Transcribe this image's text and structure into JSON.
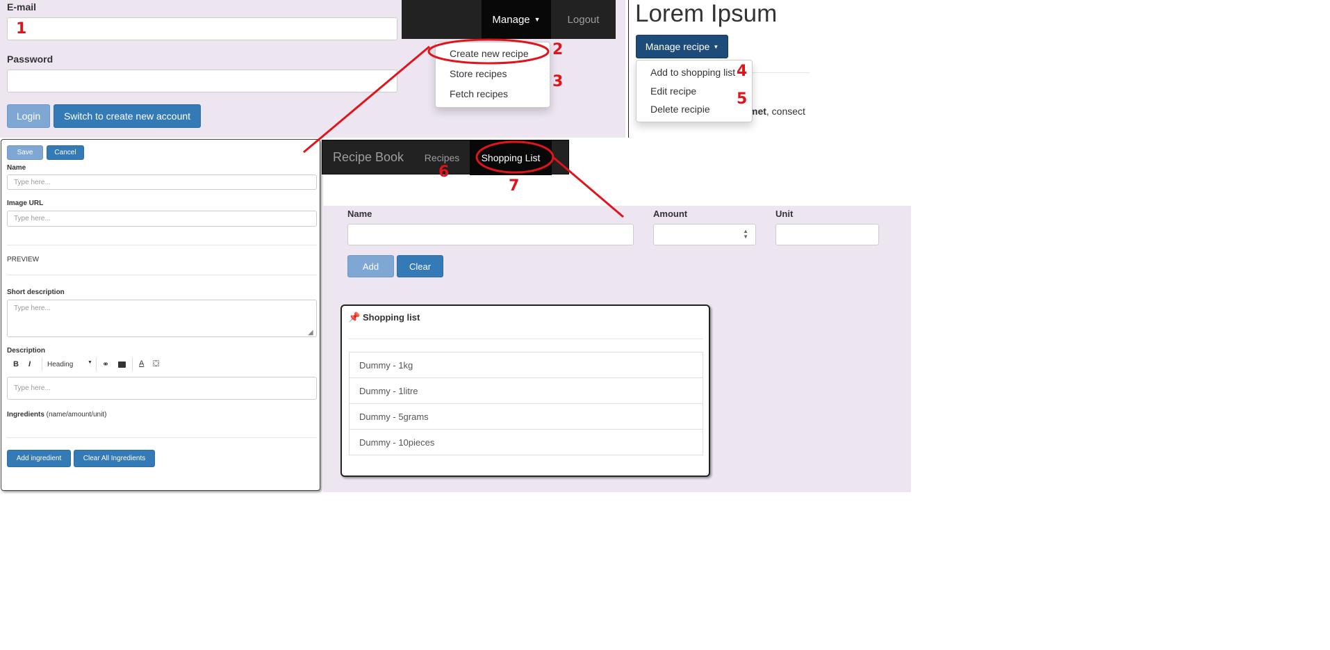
{
  "login": {
    "email_label": "E-mail",
    "password_label": "Password",
    "login_button": "Login",
    "switch_button": "Switch to create new account"
  },
  "topnav": {
    "manage": "Manage",
    "logout": "Logout",
    "menu": [
      "Create new recipe",
      "Store recipes",
      "Fetch recipes"
    ]
  },
  "recipe_detail": {
    "title": "Lorem Ipsum",
    "manage_button": "Manage recipe",
    "menu": [
      "Add to shopping list",
      "Edit recipe",
      "Delete recipie"
    ],
    "text_bold": "met",
    "text_rest": ", consect"
  },
  "recipe_form": {
    "save": "Save",
    "cancel": "Cancel",
    "name_label": "Name",
    "name_placeholder": "Type here...",
    "image_label": "Image URL",
    "image_placeholder": "Type here...",
    "preview": "PREVIEW",
    "short_desc_label": "Short description",
    "short_desc_placeholder": "Type here...",
    "description_label": "Description",
    "heading_select": "Heading",
    "description_placeholder": "Type here...",
    "ingredients_label": "Ingredients",
    "ingredients_hint": " (name/amount/unit)",
    "add_ingredient": "Add ingredient",
    "clear_ingredients": "Clear All Ingredients"
  },
  "recipe_nav": {
    "brand": "Recipe Book",
    "recipes": "Recipes",
    "shopping": "Shopping List"
  },
  "shopping": {
    "name_label": "Name",
    "amount_label": "Amount",
    "unit_label": "Unit",
    "add": "Add",
    "clear": "Clear",
    "list_title": "Shopping list",
    "items": [
      "Dummy - 1kg",
      "Dummy - 1litre",
      "Dummy - 5grams",
      "Dummy - 10pieces"
    ]
  },
  "annotations": [
    "1",
    "2",
    "3",
    "4",
    "5",
    "6",
    "7"
  ],
  "colors": {
    "annotation": "#e0141a",
    "primary": "#337ab7",
    "navbar": "#222222",
    "panel_bg": "#ede6f1"
  }
}
